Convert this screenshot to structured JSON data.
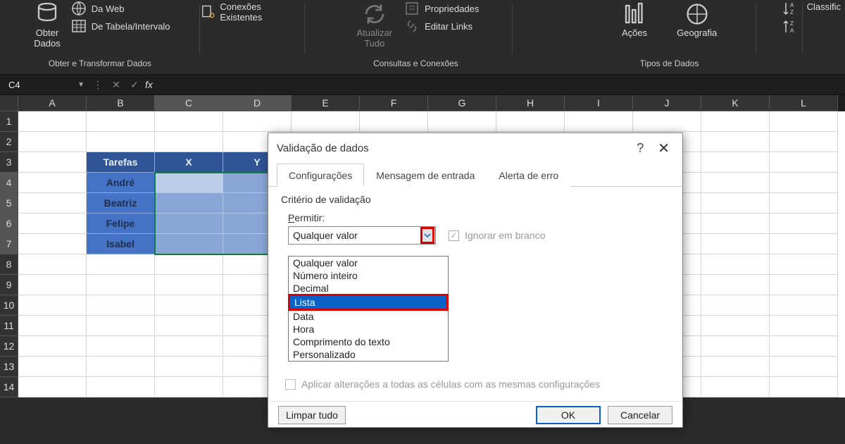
{
  "ribbon": {
    "obter_dados": "Obter\nDados",
    "da_web": "Da Web",
    "de_tabela": "De Tabela/Intervalo",
    "conexoes": "Conexões Existentes",
    "grupo1": "Obter e Transformar Dados",
    "atualizar": "Atualizar\nTudo",
    "propriedades": "Propriedades",
    "editar_links": "Editar Links",
    "grupo2": "Consultas e Conexões",
    "acoes": "Ações",
    "geografia": "Geografia",
    "grupo3": "Tipos de Dados",
    "classific": "Classific"
  },
  "formula": {
    "cell": "C4"
  },
  "cols": [
    "A",
    "B",
    "C",
    "D",
    "E",
    "F",
    "G",
    "H",
    "I",
    "J",
    "K",
    "L"
  ],
  "rows_n": [
    "1",
    "2",
    "3",
    "4",
    "5",
    "6",
    "7",
    "8",
    "9",
    "10",
    "11",
    "12",
    "13",
    "14"
  ],
  "table": {
    "h1": "Tarefas",
    "h2": "X",
    "h3": "Y",
    "r1": "André",
    "r2": "Beatriz",
    "r3": "Felipe",
    "r4": "Isabel"
  },
  "dialog": {
    "title": "Validação de dados",
    "tab1": "Configurações",
    "tab2": "Mensagem de entrada",
    "tab3": "Alerta de erro",
    "criteria": "Critério de validação",
    "permitir": "Permitir:",
    "val": "Qualquer valor",
    "ignore": "Ignorar em branco",
    "opts": [
      "Qualquer valor",
      "Número inteiro",
      "Decimal",
      "Lista",
      "Data",
      "Hora",
      "Comprimento do texto",
      "Personalizado"
    ],
    "apply": "Aplicar alterações a todas as células com as mesmas configurações",
    "clear": "Limpar tudo",
    "ok": "OK",
    "cancel": "Cancelar"
  }
}
